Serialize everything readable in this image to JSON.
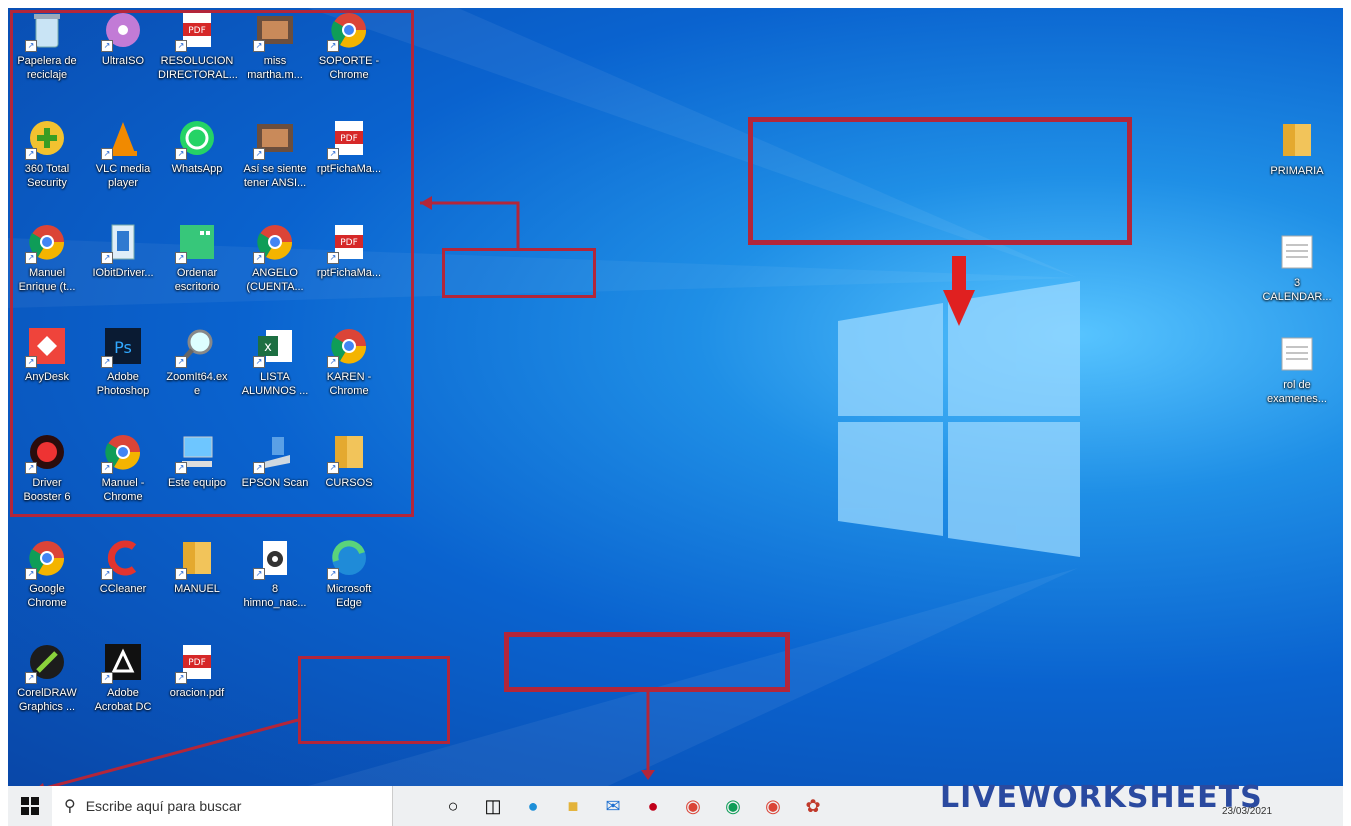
{
  "desktop_icons": [
    {
      "label": "Papelera de\nreciclaje",
      "icon": "recycle-bin-icon"
    },
    {
      "label": "UltraISO",
      "icon": "disc-icon"
    },
    {
      "label": "RESOLUCION\nDIRECTORAL...",
      "icon": "pdf-icon"
    },
    {
      "label": "miss\nmartha.m...",
      "icon": "photo-icon"
    },
    {
      "label": "SOPORTE -\nChrome",
      "icon": "chrome-icon"
    },
    {
      "label": "360 Total\nSecurity",
      "icon": "shield-icon"
    },
    {
      "label": "VLC media\nplayer",
      "icon": "vlc-icon"
    },
    {
      "label": "WhatsApp",
      "icon": "whatsapp-icon"
    },
    {
      "label": "Así se siente\ntener ANSI...",
      "icon": "photo-icon"
    },
    {
      "label": "rptFichaMa...",
      "icon": "pdf-icon"
    },
    {
      "label": "Manuel\nEnrique (t...",
      "icon": "chrome-icon"
    },
    {
      "label": "IObitDriver...",
      "icon": "file-icon"
    },
    {
      "label": "Ordenar\nescritorio",
      "icon": "app-icon"
    },
    {
      "label": "ANGELO\n(CUENTA...",
      "icon": "chrome-icon"
    },
    {
      "label": "rptFichaMa...",
      "icon": "pdf-icon"
    },
    {
      "label": "AnyDesk",
      "icon": "anydesk-icon"
    },
    {
      "label": "Adobe\nPhotoshop",
      "icon": "photoshop-icon"
    },
    {
      "label": "ZoomIt64.ex\ne",
      "icon": "magnifier-icon"
    },
    {
      "label": "LISTA\nALUMNOS ...",
      "icon": "excel-icon"
    },
    {
      "label": "KAREN -\nChrome",
      "icon": "chrome-icon"
    },
    {
      "label": "Driver\nBooster 6",
      "icon": "gear-icon"
    },
    {
      "label": "Manuel -\nChrome",
      "icon": "chrome-icon"
    },
    {
      "label": "Este equipo",
      "icon": "computer-icon"
    },
    {
      "label": "EPSON Scan",
      "icon": "scanner-icon"
    },
    {
      "label": "CURSOS",
      "icon": "folder-icon"
    },
    {
      "label": "Google\nChrome",
      "icon": "chrome-icon"
    },
    {
      "label": "CCleaner",
      "icon": "ccleaner-icon"
    },
    {
      "label": "MANUEL",
      "icon": "folder-icon"
    },
    {
      "label": "8\nhimno_nac...",
      "icon": "audio-icon"
    },
    {
      "label": "Microsoft\nEdge",
      "icon": "edge-icon"
    },
    {
      "label": "CorelDRAW\nGraphics ...",
      "icon": "corel-icon"
    },
    {
      "label": "Adobe\nAcrobat DC",
      "icon": "acrobat-icon"
    },
    {
      "label": "oracion.pdf",
      "icon": "pdf-icon"
    }
  ],
  "right_icons": [
    {
      "label": "PRIMARIA",
      "icon": "folder-icon"
    },
    {
      "label": "3\nCALENDAR...",
      "icon": "document-icon"
    },
    {
      "label": "rol de\nexamenes...",
      "icon": "document-icon"
    }
  ],
  "taskbar": {
    "search_placeholder": "Escribe aquí para buscar",
    "clock": "23/03/2021"
  },
  "watermark": "LIVEWORKSHEETS",
  "colors": {
    "accent": "#b3263a",
    "desktop": "#0a63cf"
  }
}
